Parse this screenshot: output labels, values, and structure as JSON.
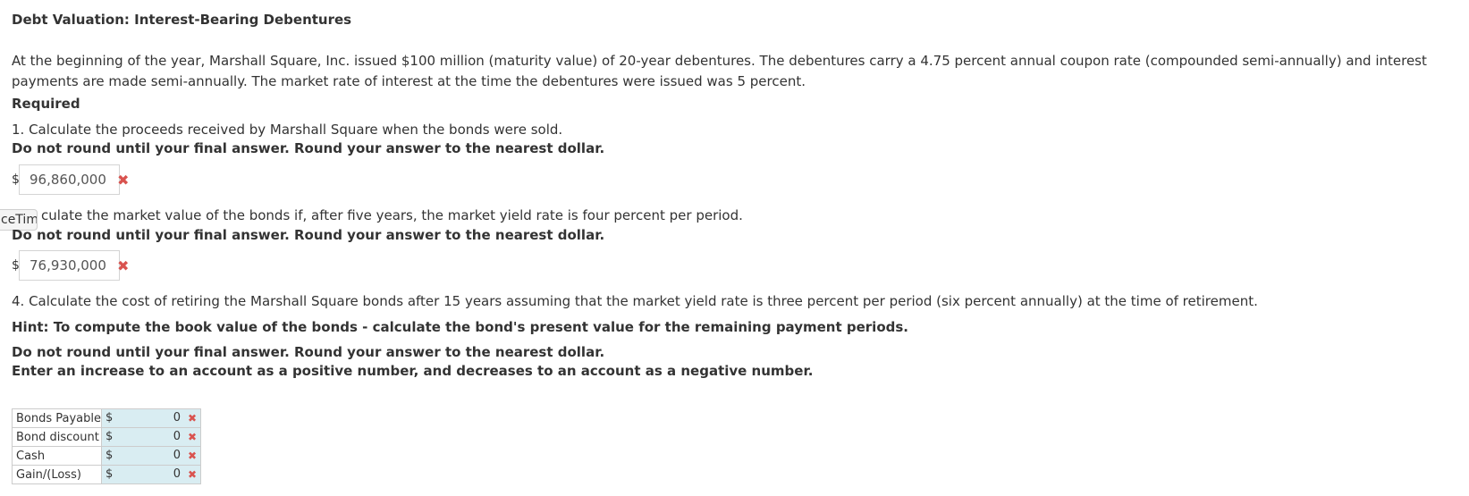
{
  "title": "Debt Valuation: Interest-Bearing Debentures",
  "intro": "At the beginning of the year, Marshall Square, Inc. issued $100 million (maturity value) of 20-year debentures. The debentures carry a 4.75 percent annual coupon rate (compounded semi-annually) and interest payments are made semi-annually. The market rate of interest at the time the debentures were issued was 5 percent.",
  "required_label": "Required",
  "q1": {
    "text": "1. Calculate the proceeds received by Marshall Square when the bonds were sold.",
    "instruction": "Do not round until your final answer. Round your answer to the nearest dollar.",
    "currency": "$",
    "answer": "96,860,000",
    "status_icon": "x-mark-icon"
  },
  "tooltip": "ceTime",
  "q2": {
    "text": "culate the market value of the bonds if, after five years, the market yield rate is four percent per period.",
    "instruction": "Do not round until your final answer. Round your answer to the nearest dollar.",
    "currency": "$",
    "answer": "76,930,000",
    "status_icon": "x-mark-icon"
  },
  "q4": {
    "text": "4. Calculate the cost of retiring the Marshall Square bonds after 15 years assuming that the market yield rate is three percent per period (six percent annually) at the time of retirement.",
    "hint": "Hint: To compute the book value of the bonds - calculate the bond's present value for the remaining payment periods.",
    "instruction1": "Do not round until your final answer. Round your answer to the nearest dollar.",
    "instruction2": "Enter an increase to an account as a positive number, and decreases to an account as a negative number."
  },
  "table": {
    "rows": [
      {
        "label": "Bonds Payable",
        "currency": "$",
        "value": "0"
      },
      {
        "label": "Bond discount",
        "currency": "$",
        "value": "0"
      },
      {
        "label": "Cash",
        "currency": "$",
        "value": "0"
      },
      {
        "label": "Gain/(Loss)",
        "currency": "$",
        "value": "0"
      }
    ]
  },
  "colors": {
    "error": "#d9534f",
    "input_fill": "#d9edf2",
    "border": "#cccccc"
  }
}
